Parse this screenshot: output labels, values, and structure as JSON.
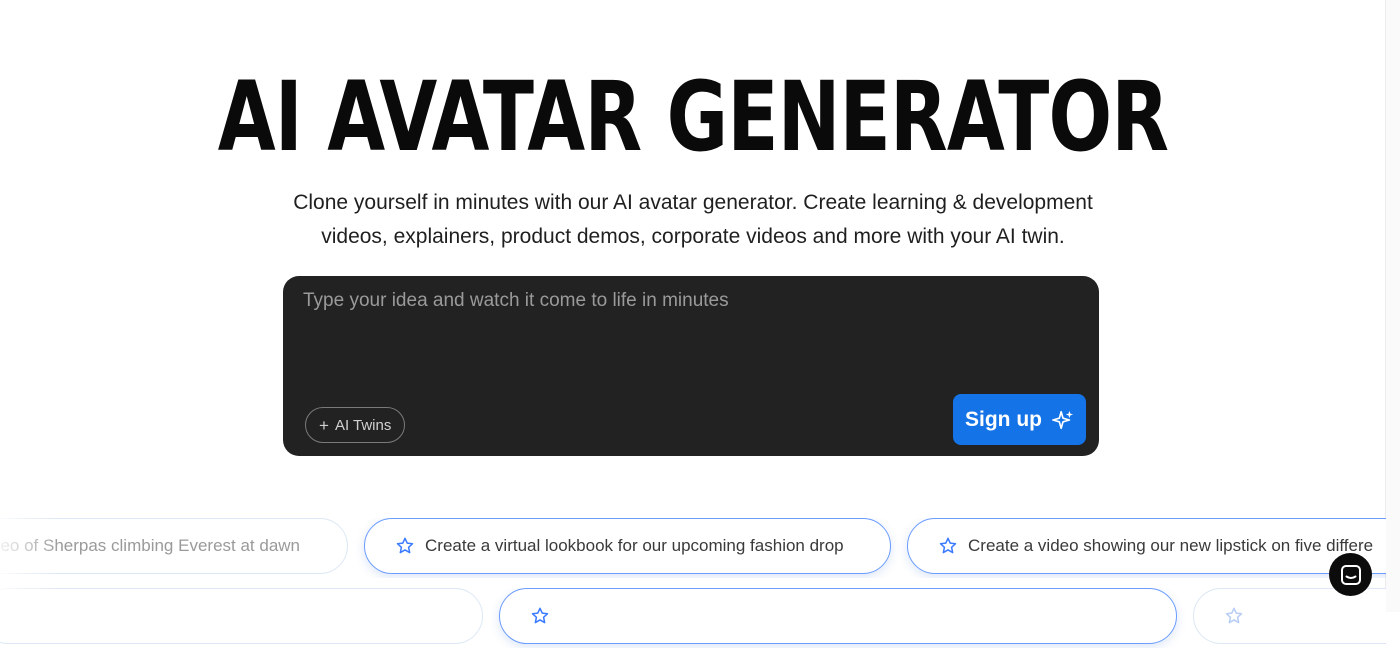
{
  "hero": {
    "title": "AI AVATAR GENERATOR",
    "subtitle_line1": "Clone yourself in minutes with our AI avatar generator. Create learning & development",
    "subtitle_line2": "videos, explainers, product demos, corporate videos and more with your AI twin."
  },
  "prompt": {
    "placeholder": "Type your idea and watch it come to life in minutes",
    "value": "",
    "twins_label": "AI Twins",
    "twins_icon": "plus-icon",
    "signup_label": "Sign up",
    "signup_icon": "sparkle-icon",
    "signup_color": "#1473e6",
    "box_color": "#222222"
  },
  "suggestions_row1": [
    {
      "label": "deo of Sherpas climbing Everest at dawn",
      "icon": "none",
      "state": "faded"
    },
    {
      "label": "Create a virtual lookbook for our upcoming fashion drop",
      "icon": "star-icon",
      "state": "active"
    },
    {
      "label": "Create a video showing our new lipstick on five differe",
      "icon": "star-icon",
      "state": "active"
    }
  ],
  "suggestions_row2": [
    {
      "label": "",
      "state": "faded"
    },
    {
      "label": "",
      "icon": "star-icon",
      "state": "active"
    },
    {
      "label": "",
      "icon": "star-icon",
      "state": "faded"
    }
  ],
  "chat": {
    "icon": "chat-icon"
  }
}
